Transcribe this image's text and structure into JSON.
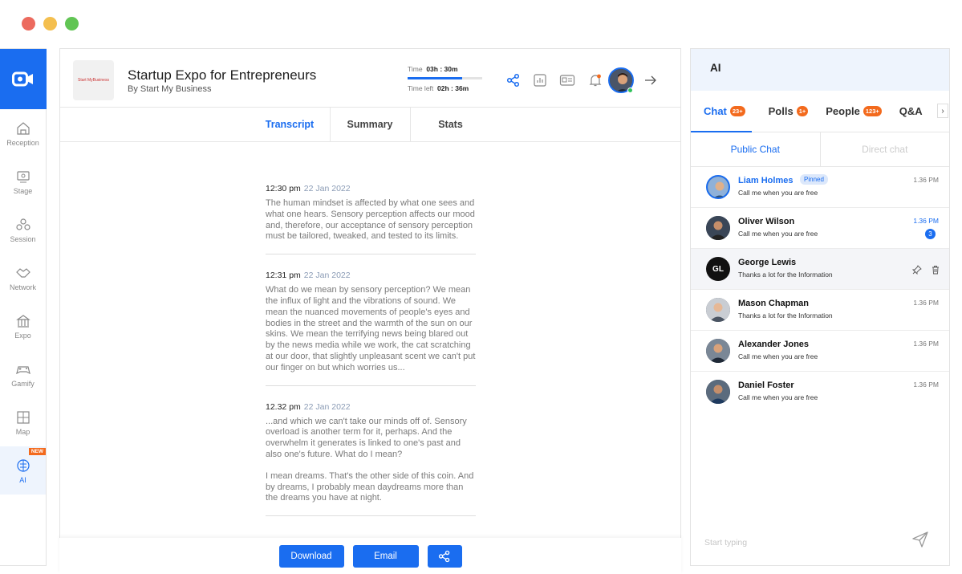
{
  "event": {
    "title": "Startup Expo for Entrepreneurs",
    "byline": "By Start My Business",
    "brand_logo_text": "Start MyBusiness"
  },
  "timer": {
    "time_label": "Time",
    "time_value": "03h : 30m",
    "left_label": "Time left",
    "left_value": "02h : 36m",
    "progress": 0.73
  },
  "sidebar": {
    "items": [
      {
        "label": "Reception",
        "icon": "reception-icon"
      },
      {
        "label": "Stage",
        "icon": "stage-icon"
      },
      {
        "label": "Session",
        "icon": "session-icon"
      },
      {
        "label": "Network",
        "icon": "network-icon"
      },
      {
        "label": "Expo",
        "icon": "expo-icon"
      },
      {
        "label": "Gamify",
        "icon": "gamify-icon"
      },
      {
        "label": "Map",
        "icon": "map-icon"
      },
      {
        "label": "AI",
        "icon": "ai-icon",
        "badge": "NEW",
        "active": true
      }
    ]
  },
  "tabs": [
    "Transcript",
    "Summary",
    "Stats"
  ],
  "transcript": [
    {
      "time": "12:30 pm",
      "date": "22 Jan 2022",
      "paragraphs": [
        "The human mindset is affected by what one sees and what one hears. Sensory perception affects our mood and, therefore, our acceptance of sensory perception must be tailored, tweaked, and tested to its limits."
      ]
    },
    {
      "time": "12:31 pm",
      "date": "22 Jan 2022",
      "paragraphs": [
        "What do we mean by sensory perception? We mean the influx of light and the vibrations of sound. We mean the nuanced movements of people's eyes and bodies in the street and the warmth of the sun on our skins. We mean the terrifying news being blared out by the news media while we work, the cat scratching at our door, that slightly unpleasant scent we can't put our finger on but which worries us..."
      ]
    },
    {
      "time": "12.32 pm",
      "date": "22 Jan 2022",
      "paragraphs": [
        "...and which we can't take our minds off of. Sensory overload is another term for it, perhaps. And the overwhelm it generates is linked to one's past and also one's future. What do I mean?",
        "I mean dreams. That's the other side of this coin. And by dreams, I probably mean daydreams more than the dreams you have at night."
      ]
    }
  ],
  "footer": {
    "download": "Download",
    "email": "Email"
  },
  "right_panel": {
    "title": "AI",
    "tabs": [
      {
        "label": "Chat",
        "badge": "23+"
      },
      {
        "label": "Polls",
        "badge": "1+"
      },
      {
        "label": "People",
        "badge": "123+"
      },
      {
        "label": "Q&A",
        "badge": ""
      }
    ],
    "subtabs": [
      "Public Chat",
      "Direct chat"
    ],
    "messages": [
      {
        "name": "Liam Holmes",
        "text": "Call me when you are free",
        "time": "1.36 PM",
        "pinned": "Pinned"
      },
      {
        "name": "Oliver Wilson",
        "text": "Call me when you are free",
        "time": "1.36 PM",
        "unread": "3"
      },
      {
        "name": "George Lewis",
        "initials": "GL",
        "text": "Thanks a lot for the Information"
      },
      {
        "name": "Mason Chapman",
        "text": "Thanks a lot for the Information",
        "time": "1.36 PM"
      },
      {
        "name": "Alexander Jones",
        "text": "Call me when you are free",
        "time": "1.36 PM"
      },
      {
        "name": "Daniel Foster",
        "text": "Call me when you are free",
        "time": "1.36 PM"
      }
    ],
    "input_placeholder": "Start typing"
  },
  "colors": {
    "accent": "#1a6df0",
    "badge": "#f36a1d"
  }
}
